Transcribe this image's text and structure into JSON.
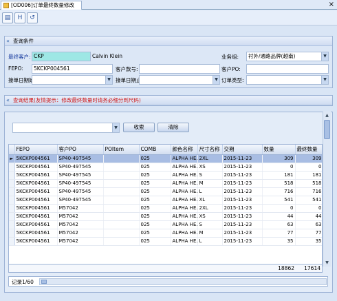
{
  "tab": {
    "title": "[OD006]订单最终数量修改"
  },
  "toolbar": {
    "close": "×",
    "btn1": "▤",
    "btn2": "H",
    "btn3": "↺"
  },
  "query": {
    "header": "查询条件",
    "customer_label": "最终客户:",
    "customer_code": "CKP",
    "customer_name": "Calvin Klein",
    "business_label": "业务组:",
    "business_value": "衬外/通路品牌(越南)",
    "fepo_label": "FEPO:",
    "fepo_value": "5KCKP004561",
    "order_no_label": "客户款号:",
    "order_no_value": "",
    "customer_po_label": "客户PO:",
    "customer_po_value": "",
    "date_from_label": "接单日期始:",
    "date_to_label": "接单日期止:",
    "order_type_label": "订单类型:"
  },
  "result": {
    "header_prefix": "查询结果",
    "header_hint": "(友情提示：修改最终数量时请务必细分到尺码)",
    "search_button": "收索",
    "clear_button": "清除",
    "columns": [
      "FEPO",
      "客户PO",
      "POItem",
      "COMB",
      "颜色名称",
      "尺寸名称",
      "交期",
      "数量",
      "最终数量"
    ],
    "rows": [
      [
        "5KCKP004561",
        "SP40-497545",
        "",
        "025",
        "ALPHA HE...",
        "2XL",
        "2015-11-23",
        "309",
        "309"
      ],
      [
        "5KCKP004561",
        "SP40-497545",
        "",
        "025",
        "ALPHA HE...",
        "XS",
        "2015-11-23",
        "0",
        "0"
      ],
      [
        "5KCKP004561",
        "SP40-497545",
        "",
        "025",
        "ALPHA HE...",
        "S",
        "2015-11-23",
        "181",
        "181"
      ],
      [
        "5KCKP004561",
        "SP40-497545",
        "",
        "025",
        "ALPHA HE...",
        "M",
        "2015-11-23",
        "518",
        "518"
      ],
      [
        "5KCKP004561",
        "SP40-497545",
        "",
        "025",
        "ALPHA HE...",
        "L",
        "2015-11-23",
        "716",
        "716"
      ],
      [
        "5KCKP004561",
        "SP40-497545",
        "",
        "025",
        "ALPHA HE...",
        "XL",
        "2015-11-23",
        "541",
        "541"
      ],
      [
        "5KCKP004561",
        "M57042",
        "",
        "025",
        "ALPHA HE...",
        "2XL",
        "2015-11-23",
        "0",
        "0"
      ],
      [
        "5KCKP004561",
        "M57042",
        "",
        "025",
        "ALPHA HE...",
        "XS",
        "2015-11-23",
        "44",
        "44"
      ],
      [
        "5KCKP004561",
        "M57042",
        "",
        "025",
        "ALPHA HE...",
        "S",
        "2015-11-23",
        "63",
        "63"
      ],
      [
        "5KCKP004561",
        "M57042",
        "",
        "025",
        "ALPHA HE...",
        "M",
        "2015-11-23",
        "77",
        "77"
      ],
      [
        "5KCKP004561",
        "M57042",
        "",
        "025",
        "ALPHA HE...",
        "L",
        "2015-11-23",
        "35",
        "35"
      ]
    ],
    "total_qty": "18862",
    "total_final": "17614",
    "record_status": "记录1/60"
  }
}
